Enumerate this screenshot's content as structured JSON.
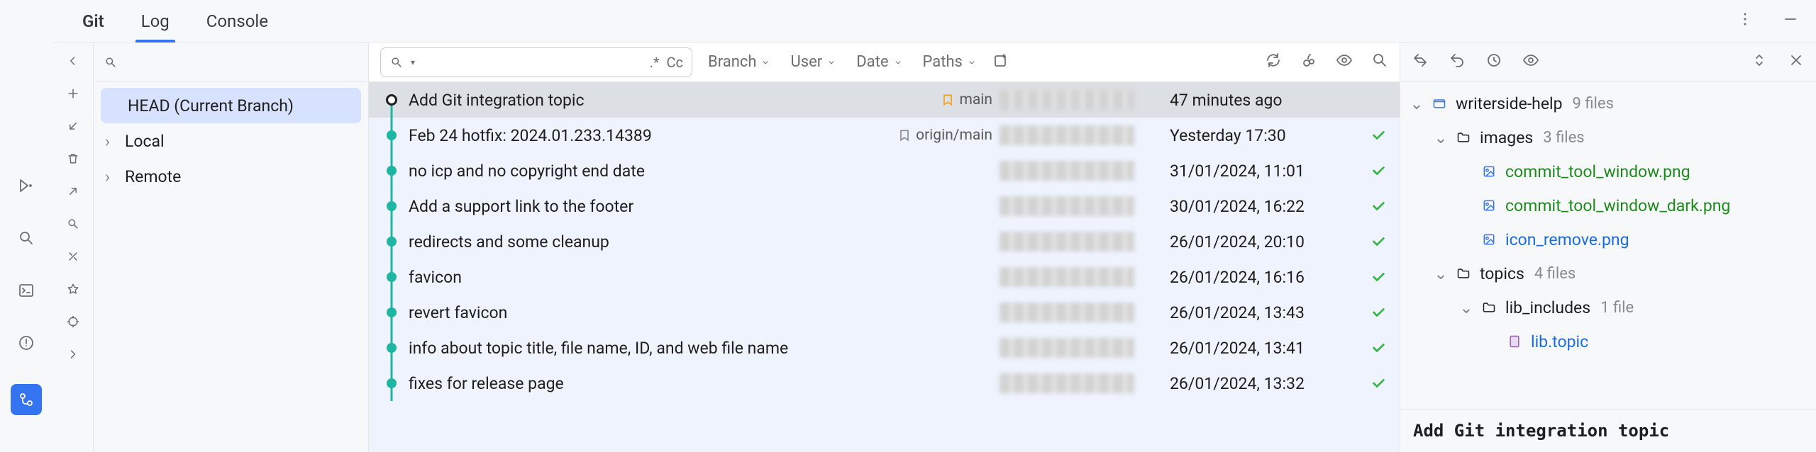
{
  "tabs": {
    "git": "Git",
    "log": "Log",
    "console": "Console"
  },
  "branches": {
    "head": "HEAD (Current Branch)",
    "local": "Local",
    "remote": "Remote"
  },
  "filters": {
    "regex": ".*",
    "case": "Cc",
    "branch": "Branch",
    "user": "User",
    "date": "Date",
    "paths": "Paths"
  },
  "log": [
    {
      "message": "Add Git integration topic",
      "ref": "main",
      "refType": "local",
      "date": "47 minutes ago",
      "status": ""
    },
    {
      "message": "Feb 24 hotfix: 2024.01.233.14389",
      "ref": "origin/main",
      "refType": "remote",
      "date": "Yesterday 17:30",
      "status": "ok"
    },
    {
      "message": "no icp and no copyright end date",
      "ref": "",
      "refType": "",
      "date": "31/01/2024, 11:01",
      "status": "ok"
    },
    {
      "message": "Add a support link to the footer",
      "ref": "",
      "refType": "",
      "date": "30/01/2024, 16:22",
      "status": "ok"
    },
    {
      "message": "redirects and some cleanup",
      "ref": "",
      "refType": "",
      "date": "26/01/2024, 20:10",
      "status": "ok"
    },
    {
      "message": "favicon",
      "ref": "",
      "refType": "",
      "date": "26/01/2024, 16:16",
      "status": "ok"
    },
    {
      "message": "revert favicon",
      "ref": "",
      "refType": "",
      "date": "26/01/2024, 13:43",
      "status": "ok"
    },
    {
      "message": "info about topic title, file name, ID, and web file name",
      "ref": "",
      "refType": "",
      "date": "26/01/2024, 13:41",
      "status": "ok"
    },
    {
      "message": "fixes for release page",
      "ref": "",
      "refType": "",
      "date": "26/01/2024, 13:32",
      "status": "ok"
    }
  ],
  "details": {
    "root": {
      "name": "writerside-help",
      "count": "9 files"
    },
    "images": {
      "name": "images",
      "count": "3 files"
    },
    "imageFiles": [
      {
        "name": "commit_tool_window.png",
        "color": "green"
      },
      {
        "name": "commit_tool_window_dark.png",
        "color": "green"
      },
      {
        "name": "icon_remove.png",
        "color": "blue"
      }
    ],
    "topics": {
      "name": "topics",
      "count": "4 files"
    },
    "libIncludes": {
      "name": "lib_includes",
      "count": "1 file"
    },
    "libTopic": {
      "name": "lib.topic",
      "color": "blue"
    },
    "commitTitle": "Add Git integration topic"
  }
}
